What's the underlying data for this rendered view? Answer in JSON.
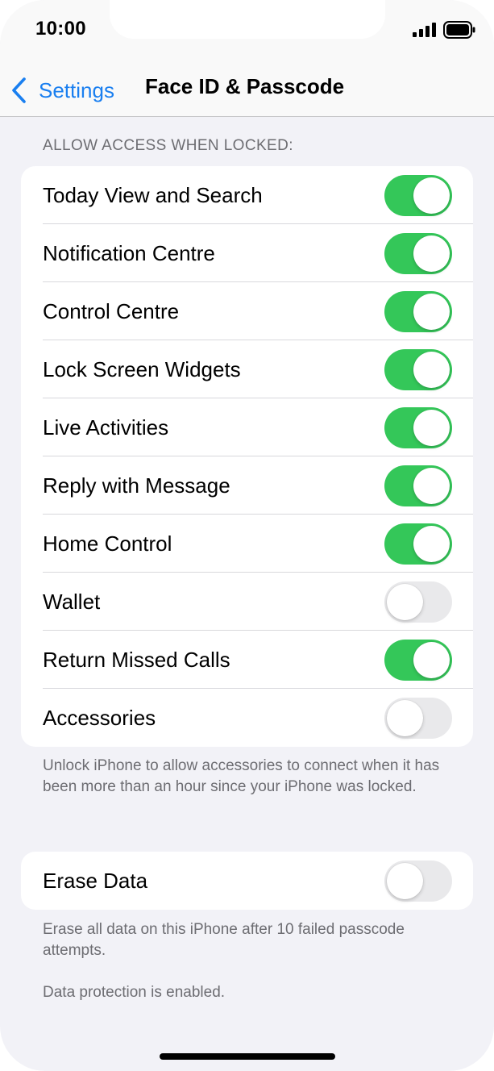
{
  "status_bar": {
    "time": "10:00"
  },
  "nav": {
    "back_label": "Settings",
    "title": "Face ID & Passcode"
  },
  "section_header": "ALLOW ACCESS WHEN LOCKED:",
  "lock_access_items": [
    {
      "label": "Today View and Search",
      "on": true
    },
    {
      "label": "Notification Centre",
      "on": true
    },
    {
      "label": "Control Centre",
      "on": true
    },
    {
      "label": "Lock Screen Widgets",
      "on": true
    },
    {
      "label": "Live Activities",
      "on": true
    },
    {
      "label": "Reply with Message",
      "on": true
    },
    {
      "label": "Home Control",
      "on": true
    },
    {
      "label": "Wallet",
      "on": false
    },
    {
      "label": "Return Missed Calls",
      "on": true
    },
    {
      "label": "Accessories",
      "on": false
    }
  ],
  "accessories_footnote": "Unlock iPhone to allow accessories to connect when it has been more than an hour since your iPhone was locked.",
  "erase_data": {
    "label": "Erase Data",
    "on": false
  },
  "erase_footnote": "Erase all data on this iPhone after 10 failed passcode attempts.",
  "protection_footnote": "Data protection is enabled.",
  "colors": {
    "accent": "#1a7ff0",
    "toggle_on": "#34c759",
    "toggle_off": "#e9e9eb",
    "background": "#f2f2f7"
  }
}
